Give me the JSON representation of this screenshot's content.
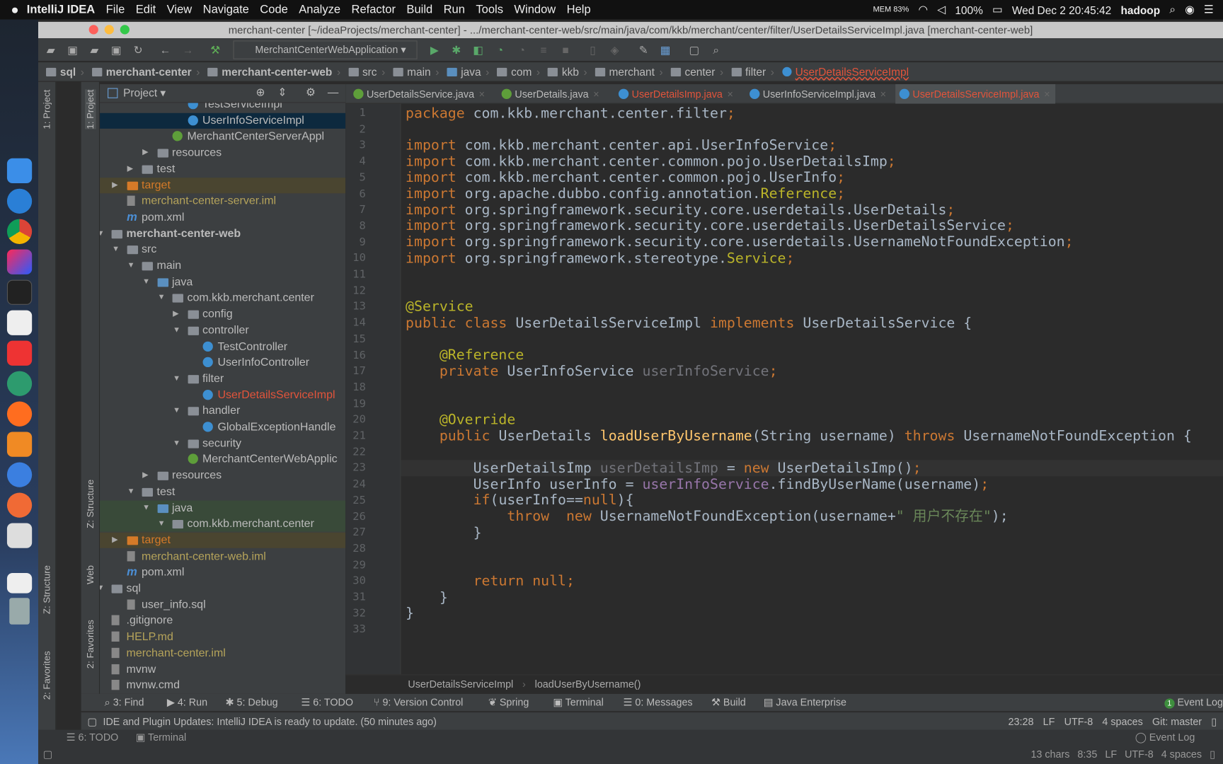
{
  "menubar": {
    "apple": "",
    "app": "IntelliJ IDEA",
    "items": [
      "File",
      "Edit",
      "View",
      "Navigate",
      "Code",
      "Analyze",
      "Refactor",
      "Build",
      "Run",
      "Tools",
      "Window",
      "Help"
    ],
    "mem": "MEM 83%",
    "battery": "100%",
    "clock": "Wed Dec 2  20:45:42",
    "user": "hadoop"
  },
  "window": {
    "title": "merchant-center [~/ideaProjects/merchant-center] - .../merchant-center-web/src/main/java/com/kkb/merchant/center/filter/UserDetailsServiceImpl.java [merchant-center-web]"
  },
  "toolbar": {
    "run_config": "MerchantCenterWebApplication"
  },
  "navbar": {
    "crumbs": [
      "sql",
      "merchant-center",
      "merchant-center-web",
      "src",
      "main",
      "java",
      "com",
      "kkb",
      "merchant",
      "center",
      "filter",
      "UserDetailsServiceImpl"
    ]
  },
  "stripes": {
    "project": "1: Project",
    "structure": "Z: Structure",
    "web": "Web",
    "favorites": "2: Favorites"
  },
  "project": {
    "header": "Project",
    "rows": [
      {
        "text": "TestServiceImpl",
        "indent": 7,
        "icon": "class",
        "arrow": ""
      },
      {
        "text": "UserInfoServiceImpl",
        "indent": 7,
        "icon": "class",
        "arrow": "",
        "selected": true
      },
      {
        "text": "MerchantCenterServerAppl",
        "indent": 6,
        "icon": "spring-class",
        "arrow": ""
      },
      {
        "text": "resources",
        "indent": 5,
        "icon": "folder",
        "arrow": "▶"
      },
      {
        "text": "test",
        "indent": 4,
        "icon": "folder",
        "arrow": "▶"
      },
      {
        "text": "target",
        "indent": 3,
        "icon": "orange-folder",
        "arrow": "▶",
        "color": "#d57a28",
        "bg": "#4a4530"
      },
      {
        "text": "merchant-center-server.iml",
        "indent": 3,
        "icon": "file",
        "arrow": "",
        "color": "#b5a35a"
      },
      {
        "text": "pom.xml",
        "indent": 3,
        "icon": "maven",
        "arrow": ""
      },
      {
        "text": "merchant-center-web",
        "indent": 2,
        "icon": "folder",
        "arrow": "▼",
        "bold": true
      },
      {
        "text": "src",
        "indent": 3,
        "icon": "folder",
        "arrow": "▼"
      },
      {
        "text": "main",
        "indent": 4,
        "icon": "folder",
        "arrow": "▼"
      },
      {
        "text": "java",
        "indent": 5,
        "icon": "blue-folder",
        "arrow": "▼"
      },
      {
        "text": "com.kkb.merchant.center",
        "indent": 6,
        "icon": "folder",
        "arrow": "▼"
      },
      {
        "text": "config",
        "indent": 7,
        "icon": "folder",
        "arrow": "▶"
      },
      {
        "text": "controller",
        "indent": 7,
        "icon": "folder",
        "arrow": "▼"
      },
      {
        "text": "TestController",
        "indent": 8,
        "icon": "class",
        "arrow": ""
      },
      {
        "text": "UserInfoController",
        "indent": 8,
        "icon": "class",
        "arrow": ""
      },
      {
        "text": "filter",
        "indent": 7,
        "icon": "folder",
        "arrow": "▼"
      },
      {
        "text": "UserDetailsServiceImpl",
        "indent": 8,
        "icon": "class",
        "arrow": "",
        "color": "#e2543b"
      },
      {
        "text": "handler",
        "indent": 7,
        "icon": "folder",
        "arrow": "▼"
      },
      {
        "text": "GlobalExceptionHandle",
        "indent": 8,
        "icon": "class",
        "arrow": ""
      },
      {
        "text": "security",
        "indent": 7,
        "icon": "folder",
        "arrow": "▼"
      },
      {
        "text": "MerchantCenterWebApplic",
        "indent": 7,
        "icon": "spring-class",
        "arrow": ""
      },
      {
        "text": "resources",
        "indent": 5,
        "icon": "folder",
        "arrow": "▶"
      },
      {
        "text": "test",
        "indent": 4,
        "icon": "folder",
        "arrow": "▼"
      },
      {
        "text": "java",
        "indent": 5,
        "icon": "blue-folder",
        "arrow": "▼",
        "bg": "#394a39"
      },
      {
        "text": "com.kkb.merchant.center",
        "indent": 6,
        "icon": "folder",
        "arrow": "▼",
        "bg": "#394a39"
      },
      {
        "text": "target",
        "indent": 3,
        "icon": "orange-folder",
        "arrow": "▶",
        "color": "#d57a28",
        "bg": "#4a4530"
      },
      {
        "text": "merchant-center-web.iml",
        "indent": 3,
        "icon": "file",
        "arrow": "",
        "color": "#b5a35a"
      },
      {
        "text": "pom.xml",
        "indent": 3,
        "icon": "maven",
        "arrow": ""
      },
      {
        "text": "sql",
        "indent": 2,
        "icon": "folder",
        "arrow": "▼"
      },
      {
        "text": "user_info.sql",
        "indent": 3,
        "icon": "file",
        "arrow": ""
      },
      {
        "text": ".gitignore",
        "indent": 2,
        "icon": "file",
        "arrow": ""
      },
      {
        "text": "HELP.md",
        "indent": 2,
        "icon": "file",
        "arrow": "",
        "color": "#b5a35a"
      },
      {
        "text": "merchant-center.iml",
        "indent": 2,
        "icon": "file",
        "arrow": "",
        "color": "#b5a35a"
      },
      {
        "text": "mvnw",
        "indent": 2,
        "icon": "file",
        "arrow": ""
      },
      {
        "text": "mvnw.cmd",
        "indent": 2,
        "icon": "file",
        "arrow": ""
      }
    ]
  },
  "tabs": [
    {
      "label": "UserDetailsService.java",
      "icon_color": "#5e9e3a"
    },
    {
      "label": "UserDetails.java",
      "icon_color": "#5e9e3a"
    },
    {
      "label": "UserDetailsImp.java",
      "icon_color": "#3d8fd1",
      "color": "#e2543b"
    },
    {
      "label": "UserInfoServiceImpl.java",
      "icon_color": "#3d8fd1"
    },
    {
      "label": "UserDetailsServiceImpl.java",
      "icon_color": "#3d8fd1",
      "active": true
    }
  ],
  "code": [
    [
      [
        "package ",
        "kw"
      ],
      [
        "com.kkb.merchant.center.filter",
        "plain"
      ],
      [
        ";",
        "kw"
      ]
    ],
    [],
    [
      [
        "import ",
        "kw"
      ],
      [
        "com.kkb.merchant.center.api.UserInfoService",
        "plain"
      ],
      [
        ";",
        "kw"
      ]
    ],
    [
      [
        "import ",
        "kw"
      ],
      [
        "com.kkb.merchant.center.common.pojo.UserDetailsImp",
        "plain"
      ],
      [
        ";",
        "kw"
      ]
    ],
    [
      [
        "import ",
        "kw"
      ],
      [
        "com.kkb.merchant.center.common.pojo.UserInfo",
        "plain"
      ],
      [
        ";",
        "kw"
      ]
    ],
    [
      [
        "import ",
        "kw"
      ],
      [
        "org.apache.dubbo.config.annotation.",
        "plain"
      ],
      [
        "Reference",
        "ann"
      ],
      [
        ";",
        "kw"
      ]
    ],
    [
      [
        "import ",
        "kw"
      ],
      [
        "org.springframework.security.core.userdetails.UserDetails",
        "plain"
      ],
      [
        ";",
        "kw"
      ]
    ],
    [
      [
        "import ",
        "kw"
      ],
      [
        "org.springframework.security.core.userdetails.UserDetailsService",
        "plain"
      ],
      [
        ";",
        "kw"
      ]
    ],
    [
      [
        "import ",
        "kw"
      ],
      [
        "org.springframework.security.core.userdetails.UsernameNotFoundException",
        "plain"
      ],
      [
        ";",
        "kw"
      ]
    ],
    [
      [
        "import ",
        "kw"
      ],
      [
        "org.springframework.stereotype.",
        "plain"
      ],
      [
        "Service",
        "ann"
      ],
      [
        ";",
        "kw"
      ]
    ],
    [],
    [],
    [
      [
        "@Service",
        "ann"
      ]
    ],
    [
      [
        "public class ",
        "kw"
      ],
      [
        "UserDetailsServiceImpl ",
        "plain"
      ],
      [
        "implements ",
        "kw"
      ],
      [
        "UserDetailsService {",
        "plain"
      ]
    ],
    [],
    [
      [
        "    @Reference",
        "ann"
      ]
    ],
    [
      [
        "    private ",
        "kw"
      ],
      [
        "UserInfoService ",
        "plain"
      ],
      [
        "userInfoService",
        "unused"
      ],
      [
        ";",
        "kw"
      ]
    ],
    [],
    [],
    [
      [
        "    @Override",
        "ann"
      ]
    ],
    [
      [
        "    public ",
        "kw"
      ],
      [
        "UserDetails ",
        "plain"
      ],
      [
        "loadUserByUsername",
        "fn"
      ],
      [
        "(String username) ",
        "plain"
      ],
      [
        "throws ",
        "kw"
      ],
      [
        "UsernameNotFoundException {",
        "plain"
      ]
    ],
    [],
    [
      [
        "        UserDetailsImp ",
        "plain"
      ],
      [
        "userDetailsImp",
        "unused"
      ],
      [
        " = ",
        "plain"
      ],
      [
        "new ",
        "kw"
      ],
      [
        "UserDetailsImp()",
        "plain"
      ],
      [
        ";",
        "kw"
      ]
    ],
    [
      [
        "        UserInfo userInfo = ",
        "plain"
      ],
      [
        "userInfoService",
        "field"
      ],
      [
        ".findByUserName(username)",
        "plain"
      ],
      [
        ";",
        "kw"
      ]
    ],
    [
      [
        "        ",
        "plain"
      ],
      [
        "if",
        "kw"
      ],
      [
        "(userInfo==",
        "plain"
      ],
      [
        "null",
        "kw"
      ],
      [
        "){",
        "plain"
      ]
    ],
    [
      [
        "            ",
        "plain"
      ],
      [
        "throw  new ",
        "kw"
      ],
      [
        "UsernameNotFoundException(username+",
        "plain"
      ],
      [
        "\" 用户不存在\"",
        "str"
      ],
      [
        ");",
        "plain"
      ]
    ],
    [
      [
        "        }",
        "plain"
      ]
    ],
    [],
    [],
    [
      [
        "        ",
        "plain"
      ],
      [
        "return null",
        "kw"
      ],
      [
        ";",
        "kw"
      ]
    ],
    [
      [
        "    }",
        "plain"
      ]
    ],
    [
      [
        "}",
        "plain"
      ]
    ],
    []
  ],
  "current_line": 23,
  "editor_breadcrumb": [
    "UserDetailsServiceImpl",
    "loadUserByUsername()"
  ],
  "toolwindows": [
    {
      "icon": "search-icon",
      "label": "3: Find"
    },
    {
      "icon": "run-icon",
      "label": "4: Run"
    },
    {
      "icon": "bug-icon",
      "label": "5: Debug"
    },
    {
      "icon": "list-icon",
      "label": "6: TODO"
    },
    {
      "icon": "vcs-icon",
      "label": "9: Version Control"
    },
    {
      "icon": "spring-icon",
      "label": "Spring"
    },
    {
      "icon": "terminal-icon",
      "label": "Terminal"
    },
    {
      "icon": "list-icon",
      "label": "0: Messages"
    },
    {
      "icon": "hammer-icon",
      "label": "Build"
    },
    {
      "icon": "java-ee-icon",
      "label": "Java Enterprise"
    }
  ],
  "event_log": {
    "count": "1",
    "label": "Event Log"
  },
  "status": {
    "message": "IDE and Plugin Updates: IntelliJ IDEA is ready to update. (50 minutes ago)",
    "position": "23:28",
    "line_sep": "LF",
    "encoding": "UTF-8",
    "indent": "4 spaces",
    "git": "Git: master"
  },
  "ghost": {
    "todo": "6: TODO",
    "terminal": "Terminal",
    "event_log": "Event Log",
    "chars": "13 chars",
    "position": "8:35",
    "line_sep": "LF",
    "encoding": "UTF-8",
    "indent": "4 spaces"
  }
}
